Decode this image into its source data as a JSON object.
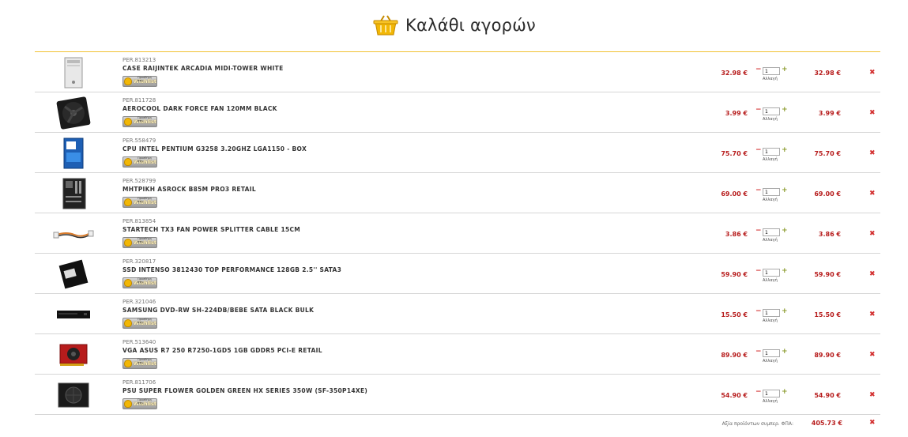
{
  "header": {
    "title": "Καλάθι αγορών",
    "icon": "basket-icon"
  },
  "wishlist": {
    "label": "Wishlist",
    "small": "Προσθήκη στη"
  },
  "qty_change_label": "Αλλαγή",
  "currency": "€",
  "colors": {
    "accent": "#f1c232",
    "price": "#b71c1c",
    "remove": "#d32f2f",
    "plus": "#8a9a2b"
  },
  "items": [
    {
      "code": "PER.813213",
      "name": "CASE RAIJINTEK ARCADIA MIDI-TOWER WHITE",
      "price": "32.98 €",
      "qty": "1",
      "total": "32.98 €",
      "icon": "pc-case-icon"
    },
    {
      "code": "PER.811728",
      "name": "AEROCOOL DARK FORCE FAN 120MM BLACK",
      "price": "3.99 €",
      "qty": "1",
      "total": "3.99 €",
      "icon": "fan-icon"
    },
    {
      "code": "PER.558479",
      "name": "CPU INTEL PENTIUM G3258 3.20GHZ LGA1150 - BOX",
      "price": "75.70 €",
      "qty": "1",
      "total": "75.70 €",
      "icon": "cpu-box-icon"
    },
    {
      "code": "PER.528799",
      "name": "ΜΗΤΡΙΚΗ ASROCK B85M PRO3 RETAIL",
      "price": "69.00 €",
      "qty": "1",
      "total": "69.00 €",
      "icon": "motherboard-icon"
    },
    {
      "code": "PER.813854",
      "name": "STARTECH TX3 FAN POWER SPLITTER CABLE 15CM",
      "price": "3.86 €",
      "qty": "1",
      "total": "3.86 €",
      "icon": "cable-icon"
    },
    {
      "code": "PER.320817",
      "name": "SSD INTENSO 3812430 TOP PERFORMANCE 128GB 2.5'' SATA3",
      "price": "59.90 €",
      "qty": "1",
      "total": "59.90 €",
      "icon": "ssd-icon"
    },
    {
      "code": "PER.321046",
      "name": "SAMSUNG DVD-RW SH-224DB/BEBE SATA BLACK BULK",
      "price": "15.50 €",
      "qty": "1",
      "total": "15.50 €",
      "icon": "dvd-drive-icon"
    },
    {
      "code": "PER.513640",
      "name": "VGA ASUS R7 250 R7250-1GD5 1GB GDDR5 PCI-E RETAIL",
      "price": "89.90 €",
      "qty": "1",
      "total": "89.90 €",
      "icon": "graphics-card-icon"
    },
    {
      "code": "PER.811706",
      "name": "PSU SUPER FLOWER GOLDEN GREEN HX SERIES 350W (SF-350P14XE)",
      "price": "54.90 €",
      "qty": "1",
      "total": "54.90 €",
      "icon": "power-supply-icon"
    }
  ],
  "summary": {
    "label": "Αξία προϊόντων συμπερ. ΦΠΑ:",
    "value": "405.73 €"
  }
}
